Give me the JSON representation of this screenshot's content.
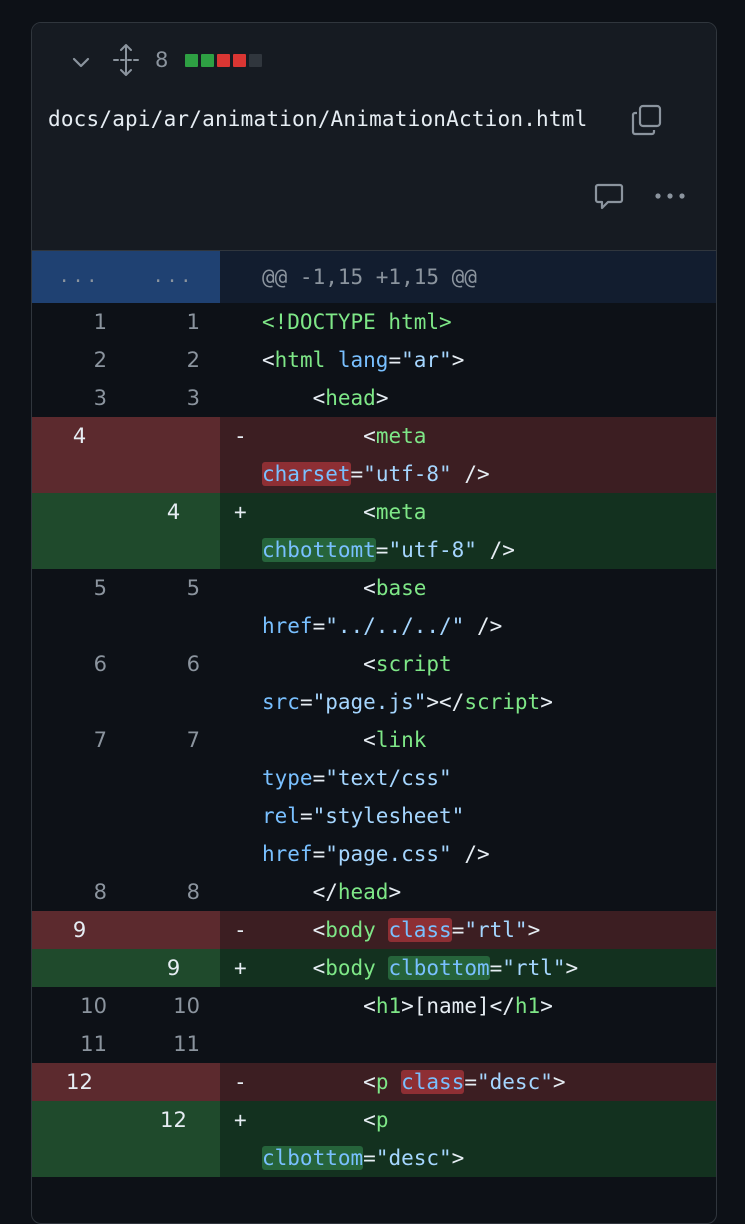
{
  "file": {
    "change_count": "8",
    "diffstat_colors": [
      "#2ea043",
      "#2ea043",
      "#da3633",
      "#da3633",
      "#30363d"
    ],
    "path": "docs/api/ar/animation/AnimationAction.html"
  },
  "icons": {
    "collapse": "chevron-down-icon",
    "expand": "unfold-icon",
    "copy": "copy-icon",
    "comment": "comment-icon",
    "more": "kebab-horizontal-icon"
  },
  "hunk": {
    "old_dots": "...",
    "new_dots": "...",
    "header": "@@ -1,15 +1,15 @@"
  },
  "rows": [
    {
      "type": "ctx",
      "old": "1",
      "new": "1",
      "marker": "",
      "lines": [
        [
          "!DOCTYPE",
          "<!DOCTYPE "
        ],
        [
          "html",
          "html>"
        ]
      ]
    },
    {
      "type": "ctx",
      "old": "2",
      "new": "2",
      "marker": "",
      "lines": []
    },
    {
      "type": "ctx",
      "old": "3",
      "new": "3",
      "marker": "",
      "lines": []
    },
    {
      "type": "del",
      "old": "4",
      "new": "",
      "marker": "-"
    },
    {
      "type": "add",
      "old": "",
      "new": "4",
      "marker": "+"
    },
    {
      "type": "ctx",
      "old": "5",
      "new": "5",
      "marker": ""
    },
    {
      "type": "ctx",
      "old": "6",
      "new": "6",
      "marker": ""
    },
    {
      "type": "ctx",
      "old": "7",
      "new": "7",
      "marker": ""
    },
    {
      "type": "ctx",
      "old": "8",
      "new": "8",
      "marker": ""
    },
    {
      "type": "del",
      "old": "9",
      "new": "",
      "marker": "-"
    },
    {
      "type": "add",
      "old": "",
      "new": "9",
      "marker": "+"
    },
    {
      "type": "ctx",
      "old": "10",
      "new": "10",
      "marker": ""
    },
    {
      "type": "ctx",
      "old": "11",
      "new": "11",
      "marker": ""
    },
    {
      "type": "del",
      "old": "12",
      "new": "",
      "marker": "-"
    },
    {
      "type": "add",
      "old": "",
      "new": "12",
      "marker": "+"
    }
  ],
  "code": {
    "r1": {
      "a": "<!DOCTYPE html>"
    },
    "r2": {
      "a": "<",
      "tag": "html",
      "attr": " lang",
      "eq": "=",
      "str": "\"ar\"",
      "end": ">"
    },
    "r3": {
      "indent": "    ",
      "a": "<",
      "tag": "head",
      "end": ">"
    },
    "r4": {
      "indent": "        ",
      "a": "<",
      "tag": "meta",
      "attr": "charset",
      "eq": "=",
      "str": "\"utf-8\"",
      "end": " />"
    },
    "r5": {
      "indent": "        ",
      "a": "<",
      "tag": "meta",
      "attr": "chbottomt",
      "eq": "=",
      "str": "\"utf-8\"",
      "end": " />"
    },
    "r6": {
      "indent": "        ",
      "a": "<",
      "tag": "base",
      "attr": "href",
      "eq": "=",
      "str": "\"../../../\"",
      "end": " />"
    },
    "r7": {
      "indent": "        ",
      "a": "<",
      "tag": "script",
      "attr": "src",
      "eq": "=",
      "str": "\"page.js\"",
      "mid": "></",
      "tag2": "script",
      "end": ">"
    },
    "r8": {
      "indent": "        ",
      "a": "<",
      "tag": "link",
      "attr1": "type",
      "str1": "\"text/css\"",
      "attr2": "rel",
      "str2": "\"stylesheet\"",
      "attr3": "href",
      "str3": "\"page.css\"",
      "eq": "=",
      "end": " />"
    },
    "r9": {
      "indent": "    ",
      "a": "</",
      "tag": "head",
      "end": ">"
    },
    "r10": {
      "indent": "    ",
      "a": "<",
      "tag": "body",
      "attr": "class",
      "eq": "=",
      "str": "\"rtl\"",
      "end": ">"
    },
    "r11": {
      "indent": "    ",
      "a": "<",
      "tag": "body",
      "attr": "clbottom",
      "eq": "=",
      "str": "\"rtl\"",
      "end": ">"
    },
    "r12": {
      "indent": "        ",
      "a": "<",
      "tag": "h1",
      "mid": ">[name]</",
      "tag2": "h1",
      "end": ">"
    },
    "r13": {
      "indent": ""
    },
    "r14": {
      "indent": "        ",
      "a": "<",
      "tag": "p",
      "attr": "class",
      "eq": "=",
      "str": "\"desc\"",
      "end": ">"
    },
    "r15": {
      "indent": "        ",
      "a": "<",
      "tag": "p",
      "attr": "clbottom",
      "eq": "=",
      "str": "\"desc\"",
      "end": ">"
    }
  }
}
